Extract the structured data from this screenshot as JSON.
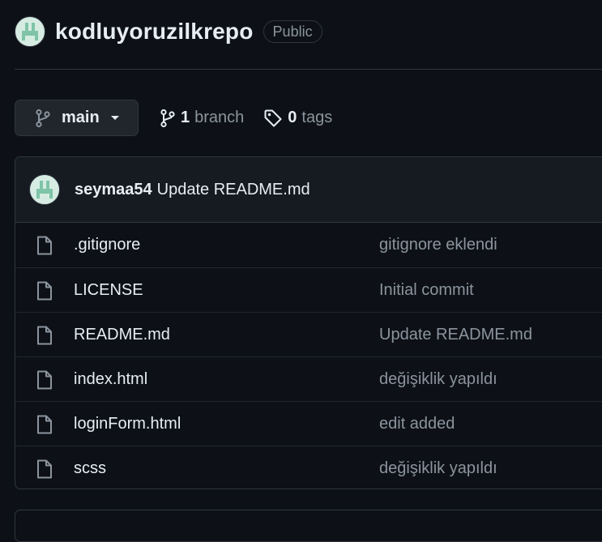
{
  "repo": {
    "name": "kodluyoruzilkrepo",
    "visibility": "Public"
  },
  "branch_bar": {
    "current_branch": "main",
    "branch_count": "1",
    "branch_word": "branch",
    "tag_count": "0",
    "tag_word": "tags"
  },
  "latest_commit": {
    "author": "seymaa54",
    "message": "Update README.md"
  },
  "files": [
    {
      "name": ".gitignore",
      "commit": "gitignore eklendi",
      "icon": "file-icon"
    },
    {
      "name": "LICENSE",
      "commit": "Initial commit",
      "icon": "file-icon"
    },
    {
      "name": "README.md",
      "commit": "Update README.md",
      "icon": "file-icon"
    },
    {
      "name": "index.html",
      "commit": "değişiklik yapıldı",
      "icon": "file-icon"
    },
    {
      "name": "loginForm.html",
      "commit": "edit added",
      "icon": "file-icon"
    },
    {
      "name": "scss",
      "commit": "değişiklik yapıldı",
      "icon": "file-icon"
    }
  ],
  "colors": {
    "background": "#0d1117",
    "header_bg": "#161b22",
    "border": "#30363d",
    "text": "#e6edf3",
    "muted": "#8b949e",
    "avatar": "#d6ece3"
  }
}
